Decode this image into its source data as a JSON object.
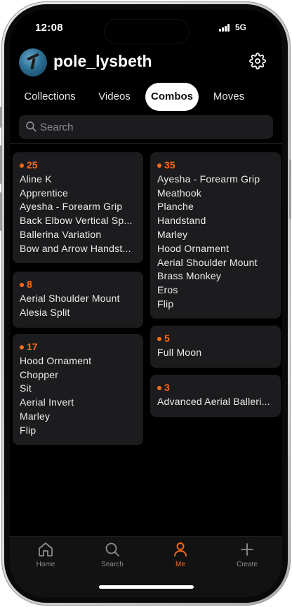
{
  "status": {
    "time": "12:08",
    "network": "5G"
  },
  "profile": {
    "username": "pole_lysbeth"
  },
  "tabs": [
    {
      "label": "Collections",
      "active": false
    },
    {
      "label": "Videos",
      "active": false
    },
    {
      "label": "Combos",
      "active": true
    },
    {
      "label": "Moves",
      "active": false
    }
  ],
  "search": {
    "placeholder": "Search"
  },
  "combos": [
    {
      "count": "25",
      "items": [
        "Aline K",
        "Apprentice",
        "Ayesha - Forearm Grip",
        "Back Elbow Vertical Sp...",
        "Ballerina Variation",
        "Bow and Arrow Handst..."
      ]
    },
    {
      "count": "35",
      "items": [
        "Ayesha - Forearm Grip",
        "Meathook",
        "Planche",
        "Handstand",
        "Marley",
        "Hood Ornament",
        "Aerial Shoulder Mount",
        "Brass Monkey",
        "Eros",
        "Flip"
      ]
    },
    {
      "count": "8",
      "items": [
        "Aerial Shoulder Mount",
        "Alesia Split"
      ]
    },
    {
      "count": "5",
      "items": [
        "Full Moon"
      ]
    },
    {
      "count": "17",
      "items": [
        "Hood Ornament",
        "Chopper",
        "Sit",
        "Aerial Invert",
        "Marley",
        "Flip"
      ]
    },
    {
      "count": "3",
      "items": [
        "Advanced Aerial Balleri..."
      ]
    }
  ],
  "nav": [
    {
      "label": "Home",
      "icon": "home-icon",
      "active": false
    },
    {
      "label": "Search",
      "icon": "search-icon",
      "active": false
    },
    {
      "label": "Me",
      "icon": "person-icon",
      "active": true
    },
    {
      "label": "Create",
      "icon": "plus-icon",
      "active": false
    }
  ],
  "colors": {
    "accent": "#ff6a13",
    "card": "#1c1c1e",
    "background": "#000000"
  }
}
